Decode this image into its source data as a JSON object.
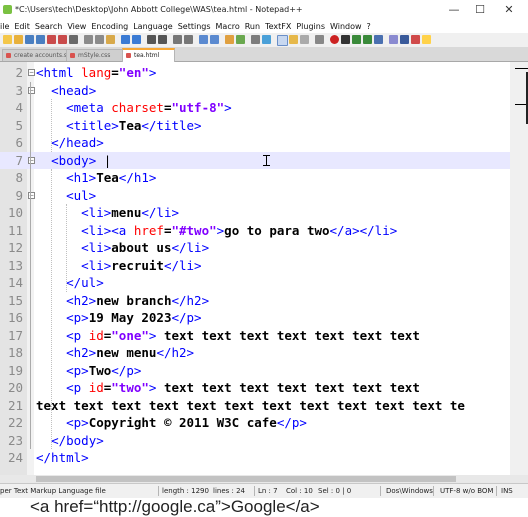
{
  "window": {
    "title": "*C:\\Users\\tech\\Desktop\\John Abbott College\\WAS\\tea.html - Notepad++",
    "minimize": "—",
    "maximize": "☐",
    "close": "✕"
  },
  "menu": [
    "ile",
    "Edit",
    "Search",
    "View",
    "Encoding",
    "Language",
    "Settings",
    "Macro",
    "Run",
    "TextFX",
    "Plugins",
    "Window",
    "?"
  ],
  "tabs": [
    {
      "label": "create accounts.sql"
    },
    {
      "label": "mStyle.css"
    },
    {
      "label": "tea.html",
      "active": true
    }
  ],
  "editor": {
    "current_line": "7",
    "lines": [
      {
        "n": "2",
        "tokens": [
          [
            "t",
            "<html "
          ],
          [
            "a",
            "lang"
          ],
          [
            "x",
            "="
          ],
          [
            "v",
            "\"en\""
          ],
          [
            "t",
            ">"
          ]
        ]
      },
      {
        "n": "3",
        "tokens": [
          [
            "",
            "  "
          ],
          [
            "t",
            "<head>"
          ]
        ]
      },
      {
        "n": "4",
        "tokens": [
          [
            "",
            "    "
          ],
          [
            "t",
            "<meta "
          ],
          [
            "a",
            "charset"
          ],
          [
            "x",
            "="
          ],
          [
            "v",
            "\"utf-8\""
          ],
          [
            "t",
            ">"
          ]
        ]
      },
      {
        "n": "5",
        "tokens": [
          [
            "",
            "    "
          ],
          [
            "t",
            "<title>"
          ],
          [
            "x",
            "Tea"
          ],
          [
            "t",
            "</title>"
          ]
        ]
      },
      {
        "n": "6",
        "tokens": [
          [
            "",
            "  "
          ],
          [
            "t",
            "</head>"
          ]
        ]
      },
      {
        "n": "7",
        "tokens": [
          [
            "",
            "  "
          ],
          [
            "t",
            "<body>"
          ],
          [
            "",
            " |"
          ]
        ]
      },
      {
        "n": "8",
        "tokens": [
          [
            "",
            "    "
          ],
          [
            "t",
            "<h1>"
          ],
          [
            "x",
            "Tea"
          ],
          [
            "t",
            "</h1>"
          ]
        ]
      },
      {
        "n": "9",
        "tokens": [
          [
            "",
            "    "
          ],
          [
            "t",
            "<ul>"
          ]
        ]
      },
      {
        "n": "10",
        "tokens": [
          [
            "",
            "      "
          ],
          [
            "t",
            "<li>"
          ],
          [
            "x",
            "menu"
          ],
          [
            "t",
            "</li>"
          ]
        ]
      },
      {
        "n": "11",
        "tokens": [
          [
            "",
            "      "
          ],
          [
            "t",
            "<li><a "
          ],
          [
            "a",
            "href"
          ],
          [
            "x",
            "="
          ],
          [
            "v",
            "\"#two\""
          ],
          [
            "t",
            ">"
          ],
          [
            "x",
            "go to para two"
          ],
          [
            "t",
            "</a></li>"
          ]
        ]
      },
      {
        "n": "12",
        "tokens": [
          [
            "",
            "      "
          ],
          [
            "t",
            "<li>"
          ],
          [
            "x",
            "about us"
          ],
          [
            "t",
            "</li>"
          ]
        ]
      },
      {
        "n": "13",
        "tokens": [
          [
            "",
            "      "
          ],
          [
            "t",
            "<li>"
          ],
          [
            "x",
            "recruit"
          ],
          [
            "t",
            "</li>"
          ]
        ]
      },
      {
        "n": "14",
        "tokens": [
          [
            "",
            "    "
          ],
          [
            "t",
            "</ul>"
          ]
        ]
      },
      {
        "n": "15",
        "tokens": [
          [
            "",
            "    "
          ],
          [
            "t",
            "<h2>"
          ],
          [
            "x",
            "new branch"
          ],
          [
            "t",
            "</h2>"
          ]
        ]
      },
      {
        "n": "16",
        "tokens": [
          [
            "",
            "    "
          ],
          [
            "t",
            "<p>"
          ],
          [
            "x",
            "19 May 2023"
          ],
          [
            "t",
            "</p>"
          ]
        ]
      },
      {
        "n": "17",
        "tokens": [
          [
            "",
            "    "
          ],
          [
            "t",
            "<p "
          ],
          [
            "a",
            "id"
          ],
          [
            "x",
            "="
          ],
          [
            "v",
            "\"one\""
          ],
          [
            "t",
            ">"
          ],
          [
            "x",
            " text text text text text text text"
          ]
        ]
      },
      {
        "n": "18",
        "tokens": [
          [
            "",
            "    "
          ],
          [
            "t",
            "<h2>"
          ],
          [
            "x",
            "new menu"
          ],
          [
            "t",
            "</h2>"
          ]
        ]
      },
      {
        "n": "19",
        "tokens": [
          [
            "",
            "    "
          ],
          [
            "t",
            "<p>"
          ],
          [
            "x",
            "Two"
          ],
          [
            "t",
            "</p>"
          ]
        ]
      },
      {
        "n": "20",
        "tokens": [
          [
            "",
            "    "
          ],
          [
            "t",
            "<p "
          ],
          [
            "a",
            "id"
          ],
          [
            "x",
            "="
          ],
          [
            "v",
            "\"two\""
          ],
          [
            "t",
            ">"
          ],
          [
            "x",
            " text text text text text text text"
          ]
        ]
      },
      {
        "n": "21",
        "tokens": [
          [
            "x",
            "text text text text text text text text text text text te"
          ]
        ]
      },
      {
        "n": "22",
        "tokens": [
          [
            "",
            "    "
          ],
          [
            "t",
            "<p>"
          ],
          [
            "x",
            "Copyright © 2011 W3C cafe"
          ],
          [
            "t",
            "</p>"
          ]
        ]
      },
      {
        "n": "23",
        "tokens": [
          [
            "",
            "  "
          ],
          [
            "t",
            "</body>"
          ]
        ]
      },
      {
        "n": "24",
        "tokens": [
          [
            "t",
            "</html>"
          ]
        ]
      }
    ]
  },
  "status": {
    "filetype": "per Text Markup Language file",
    "length": "length : 1290",
    "lines": "lines : 24",
    "ln": "Ln : 7",
    "col": "Col : 10",
    "sel": "Sel : 0 | 0",
    "eol": "Dos\\Windows",
    "encoding": "UTF-8 w/o BOM",
    "mode": "INS"
  },
  "below_text": "<a href=“http://google.ca”>Google</a>",
  "colors": {
    "tag": "#0000ff",
    "attr": "#ff0000",
    "value": "#8000ff",
    "current_line": "#e8e8ff",
    "gutter": "#e4e4e4"
  }
}
